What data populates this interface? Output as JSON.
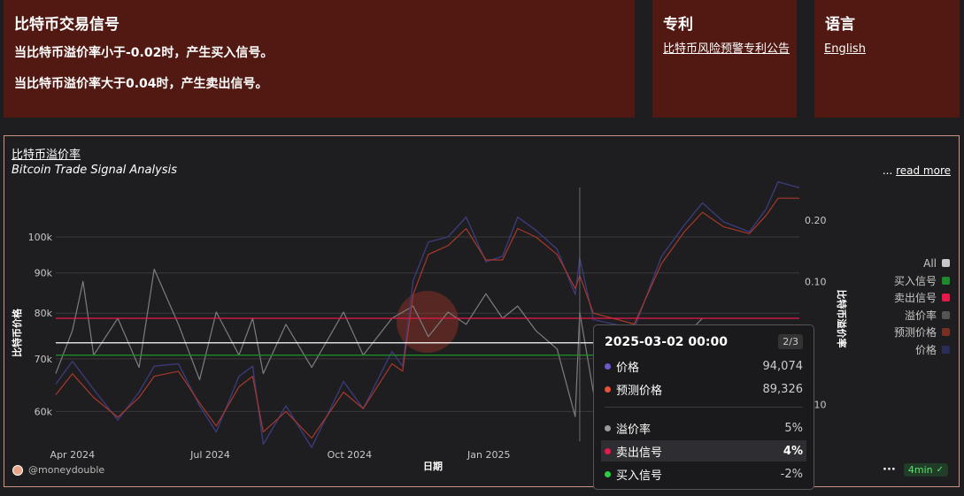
{
  "panels": {
    "signal": {
      "title": "比特币交易信号",
      "line1": "当比特币溢价率小于-0.02时，产生买入信号。",
      "line2": "当比特币溢价率大于0.04时，产生卖出信号。"
    },
    "patent": {
      "title": "专利",
      "link": "比特币风险预警专利公告"
    },
    "language": {
      "title": "语言",
      "link": "English"
    }
  },
  "card": {
    "title": "比特币溢价率",
    "subtitle": "Bitcoin Trade Signal Analysis",
    "read_more_prefix": "... ",
    "read_more": "read more",
    "credit": "@moneydouble",
    "more_dots": "···",
    "badge": "4min",
    "badge_icon": "check-circle-icon"
  },
  "legend": [
    {
      "label": "All",
      "color": "#c8c8c8"
    },
    {
      "label": "买入信号",
      "color": "#1f8a2c"
    },
    {
      "label": "卖出信号",
      "color": "#e8194a"
    },
    {
      "label": "溢价率",
      "color": "#555555"
    },
    {
      "label": "预测价格",
      "color": "#7a2f25"
    },
    {
      "label": "价格",
      "color": "#2c2c5a"
    }
  ],
  "tooltip": {
    "title": "2025-03-02 00:00",
    "page": "2/3",
    "rows": [
      {
        "label": "价格",
        "value": "94,074",
        "color": "#6a5acd"
      },
      {
        "label": "预测价格",
        "value": "89,326",
        "color": "#e8523a"
      },
      {
        "label": "溢价率",
        "value": "5%",
        "color": "#9a9a9a"
      },
      {
        "label": "卖出信号",
        "value": "4%",
        "color": "#e8194a"
      },
      {
        "label": "买入信号",
        "value": "-2%",
        "color": "#2ecc40"
      }
    ]
  },
  "chart_data": {
    "type": "line",
    "xlabel": "日期",
    "ylabel_left": "比特币价格",
    "ylabel_right": "比特币溢价率",
    "x_ticks": [
      "Apr 2024",
      "Jul 2024",
      "Oct 2024",
      "Jan 2025"
    ],
    "y_left_ticks": [
      "100k",
      "90k",
      "80k",
      "70k",
      "60k"
    ],
    "y_right_ticks": [
      "0.20",
      "0.10",
      "0.10"
    ],
    "y_left_scale": "log",
    "ylim_left": [
      55000,
      115000
    ],
    "ylim_right": [
      -0.16,
      0.25
    ],
    "sell_threshold": 0.04,
    "buy_threshold": -0.02,
    "zero_line": 0,
    "x_range": [
      "2024-03-21",
      "2025-07-25"
    ],
    "series": [
      {
        "name": "价格",
        "color": "#2c2c5a",
        "axis": "left",
        "points": [
          [
            "2024-03-21",
            65000
          ],
          [
            "2024-04-01",
            69500
          ],
          [
            "2024-04-15",
            64000
          ],
          [
            "2024-05-01",
            58500
          ],
          [
            "2024-05-15",
            63500
          ],
          [
            "2024-05-25",
            68500
          ],
          [
            "2024-06-10",
            69000
          ],
          [
            "2024-06-24",
            61000
          ],
          [
            "2024-07-05",
            56500
          ],
          [
            "2024-07-20",
            66500
          ],
          [
            "2024-07-29",
            68500
          ],
          [
            "2024-08-05",
            54500
          ],
          [
            "2024-08-20",
            61000
          ],
          [
            "2024-09-06",
            54000
          ],
          [
            "2024-09-27",
            65500
          ],
          [
            "2024-10-10",
            60500
          ],
          [
            "2024-10-29",
            71500
          ],
          [
            "2024-11-05",
            68500
          ],
          [
            "2024-11-12",
            88000
          ],
          [
            "2024-11-22",
            98500
          ],
          [
            "2024-12-05",
            100000
          ],
          [
            "2024-12-17",
            106000
          ],
          [
            "2024-12-30",
            93000
          ],
          [
            "2025-01-10",
            94500
          ],
          [
            "2025-01-20",
            106000
          ],
          [
            "2025-02-01",
            102000
          ],
          [
            "2025-02-15",
            96500
          ],
          [
            "2025-02-27",
            84500
          ],
          [
            "2025-03-02",
            94074
          ],
          [
            "2025-03-11",
            78500
          ],
          [
            "2025-04-07",
            76500
          ],
          [
            "2025-04-25",
            94500
          ],
          [
            "2025-05-10",
            103500
          ],
          [
            "2025-05-22",
            110500
          ],
          [
            "2025-06-05",
            104500
          ],
          [
            "2025-06-22",
            101500
          ],
          [
            "2025-07-03",
            108500
          ],
          [
            "2025-07-11",
            117500
          ],
          [
            "2025-07-25",
            115500
          ]
        ]
      },
      {
        "name": "预测价格",
        "color": "#7a2f25",
        "axis": "left",
        "points": [
          [
            "2024-03-21",
            63000
          ],
          [
            "2024-04-01",
            67000
          ],
          [
            "2024-04-15",
            62500
          ],
          [
            "2024-05-01",
            59000
          ],
          [
            "2024-05-15",
            62500
          ],
          [
            "2024-05-25",
            66500
          ],
          [
            "2024-06-10",
            67500
          ],
          [
            "2024-06-24",
            61500
          ],
          [
            "2024-07-05",
            57500
          ],
          [
            "2024-07-20",
            64500
          ],
          [
            "2024-07-29",
            66500
          ],
          [
            "2024-08-05",
            56500
          ],
          [
            "2024-08-20",
            60000
          ],
          [
            "2024-09-06",
            55500
          ],
          [
            "2024-09-27",
            63500
          ],
          [
            "2024-10-10",
            60500
          ],
          [
            "2024-10-29",
            69000
          ],
          [
            "2024-11-05",
            67500
          ],
          [
            "2024-11-12",
            84500
          ],
          [
            "2024-11-22",
            95000
          ],
          [
            "2024-12-05",
            97500
          ],
          [
            "2024-12-17",
            102500
          ],
          [
            "2024-12-30",
            93500
          ],
          [
            "2025-01-10",
            93500
          ],
          [
            "2025-01-20",
            102500
          ],
          [
            "2025-02-01",
            100000
          ],
          [
            "2025-02-15",
            95000
          ],
          [
            "2025-02-27",
            86000
          ],
          [
            "2025-03-02",
            89326
          ],
          [
            "2025-03-11",
            80000
          ],
          [
            "2025-04-07",
            77500
          ],
          [
            "2025-04-25",
            92500
          ],
          [
            "2025-05-10",
            101500
          ],
          [
            "2025-05-22",
            107500
          ],
          [
            "2025-06-05",
            103000
          ],
          [
            "2025-06-22",
            101000
          ],
          [
            "2025-07-03",
            106500
          ],
          [
            "2025-07-11",
            112000
          ],
          [
            "2025-07-25",
            112000
          ]
        ]
      },
      {
        "name": "溢价率",
        "color": "#7d7d7d",
        "axis": "right",
        "points": [
          [
            "2024-03-21",
            -0.05
          ],
          [
            "2024-04-01",
            0.02
          ],
          [
            "2024-04-08",
            0.1
          ],
          [
            "2024-04-15",
            -0.02
          ],
          [
            "2024-05-01",
            0.04
          ],
          [
            "2024-05-15",
            -0.04
          ],
          [
            "2024-05-25",
            0.12
          ],
          [
            "2024-06-10",
            0.03
          ],
          [
            "2024-06-24",
            -0.06
          ],
          [
            "2024-07-05",
            0.05
          ],
          [
            "2024-07-20",
            -0.02
          ],
          [
            "2024-07-29",
            0.04
          ],
          [
            "2024-08-05",
            -0.05
          ],
          [
            "2024-08-20",
            0.03
          ],
          [
            "2024-09-06",
            -0.04
          ],
          [
            "2024-09-27",
            0.05
          ],
          [
            "2024-10-10",
            -0.02
          ],
          [
            "2024-10-29",
            0.04
          ],
          [
            "2024-11-12",
            0.06
          ],
          [
            "2024-11-22",
            0.01
          ],
          [
            "2024-12-05",
            0.05
          ],
          [
            "2024-12-17",
            0.03
          ],
          [
            "2024-12-30",
            0.08
          ],
          [
            "2025-01-10",
            0.04
          ],
          [
            "2025-01-20",
            0.06
          ],
          [
            "2025-02-01",
            0.02
          ],
          [
            "2025-02-15",
            -0.01
          ],
          [
            "2025-02-27",
            -0.12
          ],
          [
            "2025-03-02",
            0.05
          ],
          [
            "2025-03-11",
            -0.08
          ],
          [
            "2025-04-07",
            -0.03
          ],
          [
            "2025-04-25",
            0.02
          ],
          [
            "2025-05-10",
            0.01
          ],
          [
            "2025-05-22",
            0.04
          ]
        ]
      }
    ]
  }
}
